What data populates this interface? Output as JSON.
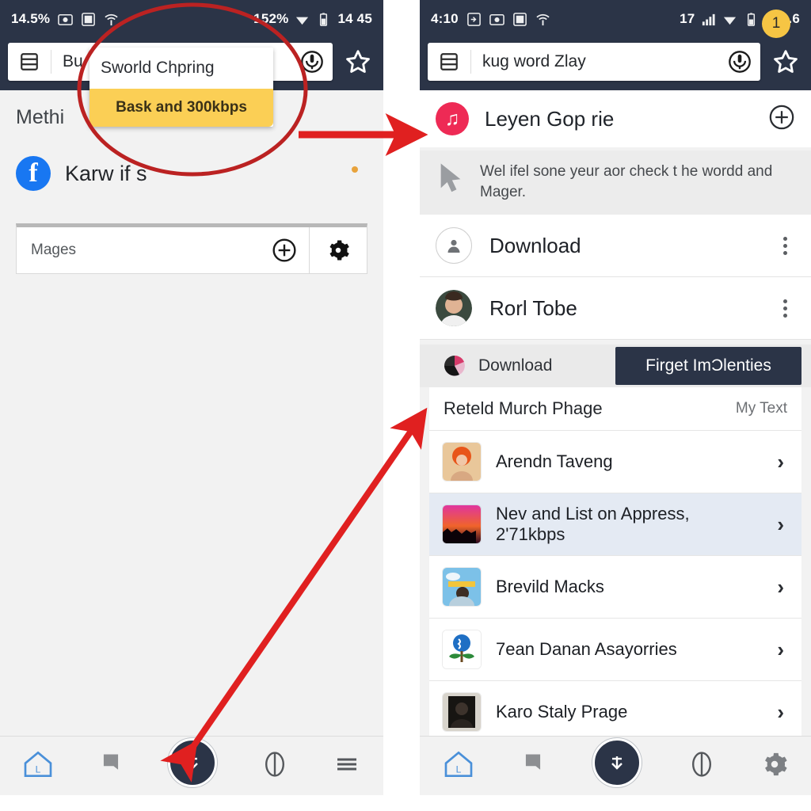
{
  "left_phone": {
    "status_bar": {
      "left_text": "14.5%",
      "icons": [
        "camera-icon",
        "sd-card-icon",
        "wifi-tether-icon"
      ],
      "right_text": "152%",
      "battery_icon": "battery-icon",
      "wifi_icon": "wifi-icon",
      "time": "14 45"
    },
    "browser_bar": {
      "menu_icon": "list-menu-icon",
      "url_value": "Bu",
      "voice_icon": "voice-search-icon",
      "star_icon": "bookmark-star-icon"
    },
    "dropdown": {
      "suggestion": "Sworld Chpring",
      "highlight": "Bask and 300kbps"
    },
    "section_title": "Methi",
    "badge": "1",
    "facebook_row": {
      "icon": "facebook-icon",
      "glyph": "f",
      "label": "Karw if s"
    },
    "card": {
      "label": "Mages",
      "add_icon": "plus-circle-icon",
      "settings_icon": "gear-icon"
    },
    "bottom_nav": [
      {
        "name": "home-icon",
        "label": "L"
      },
      {
        "name": "bookmark-icon",
        "label": ""
      },
      {
        "name": "download-fab-icon",
        "label": ""
      },
      {
        "name": "contrast-icon",
        "label": ""
      },
      {
        "name": "hamburger-menu-icon",
        "label": ""
      }
    ]
  },
  "right_phone": {
    "status_bar": {
      "time": "4:10",
      "icons": [
        "download-icon",
        "camera-icon",
        "sd-card-icon",
        "wifi-tether-icon"
      ],
      "signal_text": "17",
      "signal_icon": "signal-bars-icon",
      "wifi_icon": "wifi-icon",
      "battery_icon": "battery-icon",
      "battery_text": "193.6"
    },
    "browser_bar": {
      "menu_icon": "list-menu-icon",
      "url_value": "kug word Zlay",
      "voice_icon": "voice-search-icon",
      "star_icon": "bookmark-star-icon"
    },
    "music_row": {
      "icon": "music-note-icon",
      "label": "Leyen Gop rie",
      "add_icon": "plus-circle-icon"
    },
    "note": {
      "icon": "cursor-arrow-icon",
      "text": "Wel ifel sone yeur aor check t he wordd and Mager."
    },
    "list_items": [
      {
        "avatar": "person-avatar-icon",
        "label": "Download",
        "menu": "kebab-menu-icon"
      },
      {
        "avatar": "photo-avatar",
        "label": "Rorl Tobe",
        "menu": "kebab-menu-icon"
      }
    ],
    "tabs": [
      {
        "label": "Download",
        "icon": "chrome-ball-icon",
        "active": false
      },
      {
        "label": "Firget ImƆlenties",
        "icon": "",
        "active": true
      }
    ],
    "sub_header": {
      "title": "Reteld Murch Phage",
      "right": "My Text"
    },
    "rows": [
      {
        "label": "Arendn Taveng",
        "thumb": "orange-afro-thumb",
        "selected": false,
        "chevron": "chevron-right-icon"
      },
      {
        "label": "Nev and List on Appress, 2'71kbps",
        "thumb": "sunset-gradient-thumb",
        "selected": true,
        "chevron": "chevron-right-icon"
      },
      {
        "label": "Brevild Macks",
        "thumb": "blue-sky-thumb",
        "selected": false,
        "chevron": "chevron-right-icon"
      },
      {
        "label": "7ean Danan Asayorries",
        "thumb": "blue-flower-thumb",
        "selected": false,
        "chevron": "chevron-right-icon"
      },
      {
        "label": "Karo Staly Prage",
        "thumb": "dark-portrait-thumb",
        "selected": false,
        "chevron": "chevron-right-icon"
      }
    ],
    "bottom_nav": [
      {
        "name": "home-icon",
        "label": "L"
      },
      {
        "name": "bookmark-icon",
        "label": ""
      },
      {
        "name": "download-fab-icon",
        "label": ""
      },
      {
        "name": "contrast-icon",
        "label": ""
      },
      {
        "name": "settings-gear-icon",
        "label": ""
      }
    ]
  },
  "annotations": {
    "circle_color": "#bb2222",
    "arrow_color": "#e02020",
    "badge_color": "#f6c544",
    "ellipse": "highlight-ellipse",
    "arrow_horizontal": "arrow-right",
    "arrow_diagonal": "arrow-diagonal-double"
  }
}
